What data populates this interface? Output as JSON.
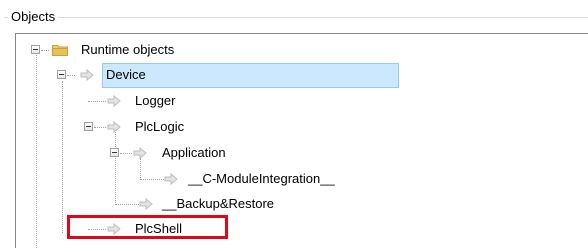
{
  "group": {
    "title": "Objects"
  },
  "tree": {
    "root": {
      "label": "Runtime objects",
      "icon": "folder-icon",
      "expanded": true
    },
    "device": {
      "label": "Device",
      "icon": "arrow-icon",
      "expanded": true,
      "selected": true
    },
    "logger": {
      "label": "Logger",
      "icon": "arrow-icon"
    },
    "plclogic": {
      "label": "PlcLogic",
      "icon": "arrow-icon",
      "expanded": true
    },
    "application": {
      "label": "Application",
      "icon": "arrow-icon",
      "expanded": true
    },
    "cmodule": {
      "label": "__C-ModuleIntegration__",
      "icon": "arrow-icon"
    },
    "backup": {
      "label": "__Backup&Restore",
      "icon": "arrow-icon"
    },
    "plcshell": {
      "label": "PlcShell",
      "icon": "arrow-icon",
      "highlighted": true
    }
  },
  "colors": {
    "selection_bg": "#cce8ff",
    "selection_border": "#99c9ef",
    "highlight_border": "#e3051b",
    "folder": "#e8c15a",
    "arrow_icon": "#c8c8c8"
  }
}
